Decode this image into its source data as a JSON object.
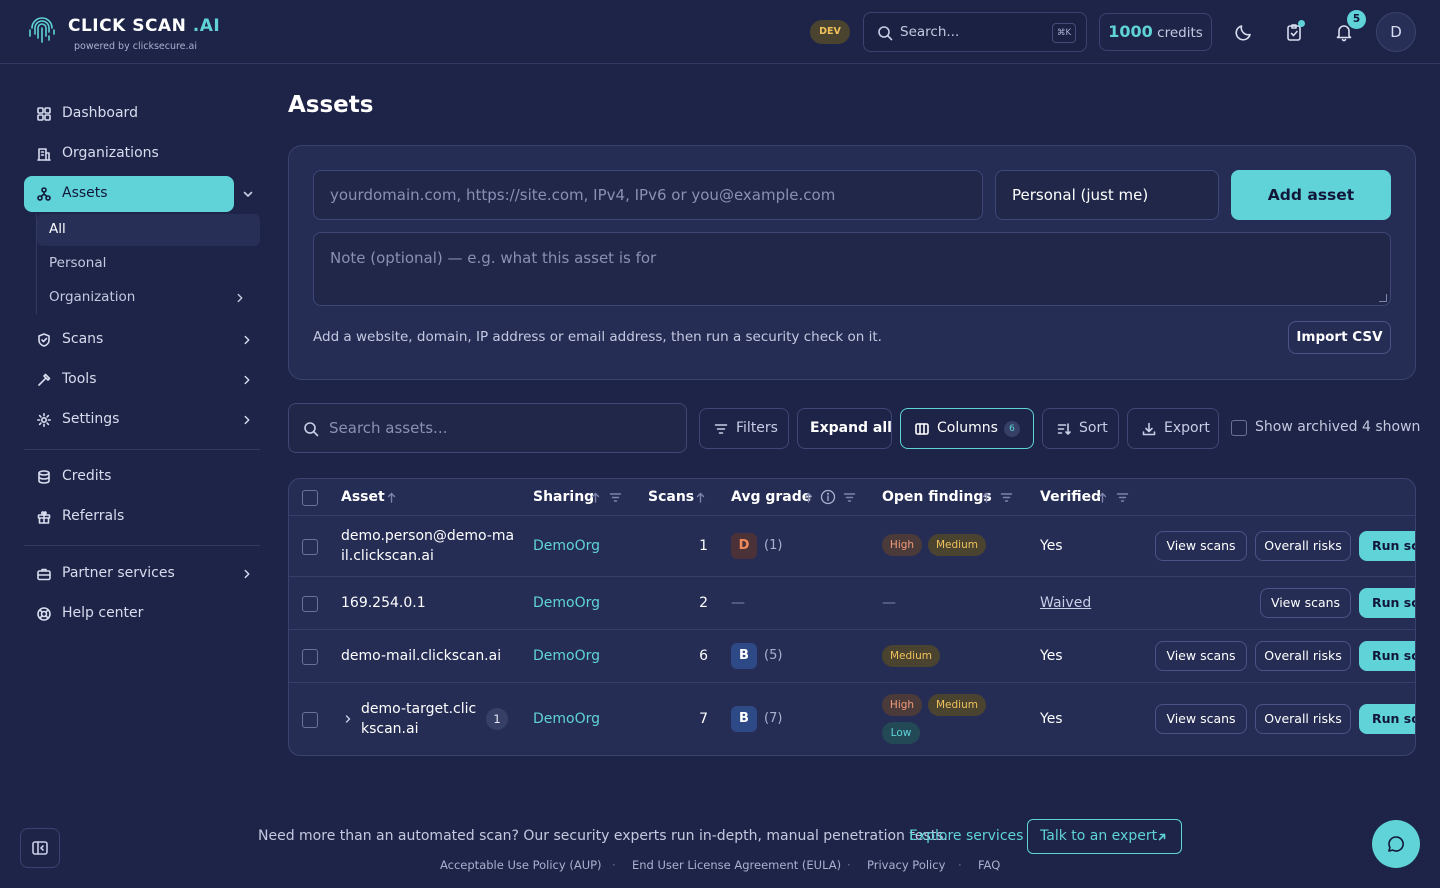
{
  "header": {
    "logo_title": "CLICK SCAN",
    "logo_title_accent": ".AI",
    "logo_subtitle": "powered by clicksecure.ai",
    "env_badge": "DEV",
    "search_placeholder": "Search...",
    "search_shortcut": "⌘K",
    "credits_value": "1000",
    "credits_label": "credits",
    "notification_count": "5",
    "avatar_initial": "D"
  },
  "sidebar": {
    "items": [
      {
        "label": "Dashboard",
        "icon": "grid-icon"
      },
      {
        "label": "Organizations",
        "icon": "building-icon"
      },
      {
        "label": "Assets",
        "icon": "assets-icon",
        "active": true
      },
      {
        "label": "Scans",
        "icon": "shield-icon"
      },
      {
        "label": "Tools",
        "icon": "hammer-icon"
      },
      {
        "label": "Settings",
        "icon": "gear-icon"
      },
      {
        "label": "Credits",
        "icon": "database-icon"
      },
      {
        "label": "Referrals",
        "icon": "gift-icon"
      },
      {
        "label": "Partner services",
        "icon": "briefcase-icon"
      },
      {
        "label": "Help center",
        "icon": "lifebuoy-icon"
      }
    ],
    "asset_subitems": [
      {
        "label": "All",
        "active": true
      },
      {
        "label": "Personal"
      },
      {
        "label": "Organization"
      }
    ]
  },
  "main": {
    "title": "Assets",
    "add_form": {
      "asset_placeholder": "yourdomain.com, https://site.com, IPv4, IPv6 or you@example.com",
      "scope_value": "Personal (just me)",
      "add_button": "Add asset",
      "note_placeholder": "Note (optional) — e.g. what this asset is for",
      "helper_text": "Add a website, domain, IP address or email address, then run a security check on it.",
      "import_button": "Import CSV"
    },
    "toolbar": {
      "search_placeholder": "Search assets...",
      "filters": "Filters",
      "expand_all": "Expand all",
      "columns": "Columns",
      "columns_count": "6",
      "sort": "Sort",
      "export": "Export",
      "show_archived": "Show archived",
      "shown_count": "4 shown"
    },
    "table": {
      "columns": [
        "Asset",
        "Sharing",
        "Scans",
        "Avg grade",
        "Open findings",
        "Verified"
      ],
      "rows": [
        {
          "asset_line1": "demo.person@demo-ma",
          "asset_line2": "il.clickscan.ai",
          "sharing": "DemoOrg",
          "scans": "1",
          "grade": "D",
          "grade_count": "(1)",
          "findings": [
            "High",
            "Medium"
          ],
          "verified": "Yes",
          "actions": [
            "View scans",
            "Overall risks",
            "Run sca"
          ]
        },
        {
          "asset_line1": "169.254.0.1",
          "sharing": "DemoOrg",
          "scans": "2",
          "grade": "—",
          "findings_text": "—",
          "verified": "Waived",
          "actions": [
            "View scans",
            "Run sca"
          ]
        },
        {
          "asset_line1": "demo-mail.clickscan.ai",
          "sharing": "DemoOrg",
          "scans": "6",
          "grade": "B",
          "grade_count": "(5)",
          "findings": [
            "Medium"
          ],
          "verified": "Yes",
          "actions": [
            "View scans",
            "Overall risks",
            "Run sca"
          ]
        },
        {
          "asset_line1": "demo-target.clic",
          "asset_line2": "kscan.ai",
          "child_count": "1",
          "sharing": "DemoOrg",
          "scans": "7",
          "grade": "B",
          "grade_count": "(7)",
          "findings": [
            "High",
            "Medium",
            "Low"
          ],
          "verified": "Yes",
          "actions": [
            "View scans",
            "Overall risks",
            "Run sca"
          ]
        }
      ]
    }
  },
  "footer": {
    "promo_text": "Need more than an automated scan? Our security experts run in-depth, manual penetration tests.",
    "promo_link": "Explore services",
    "expert_button": "Talk to an expert",
    "legal_links": [
      "Acceptable Use Policy (AUP)",
      "End User License Agreement (EULA)",
      "Privacy Policy",
      "FAQ"
    ]
  },
  "colors": {
    "background": "#1e2447",
    "card": "#262d55",
    "accent": "#5fd3d8",
    "severity_high": "#f19a7a",
    "severity_medium": "#f0c15a",
    "severity_low": "#5fd3d8"
  }
}
